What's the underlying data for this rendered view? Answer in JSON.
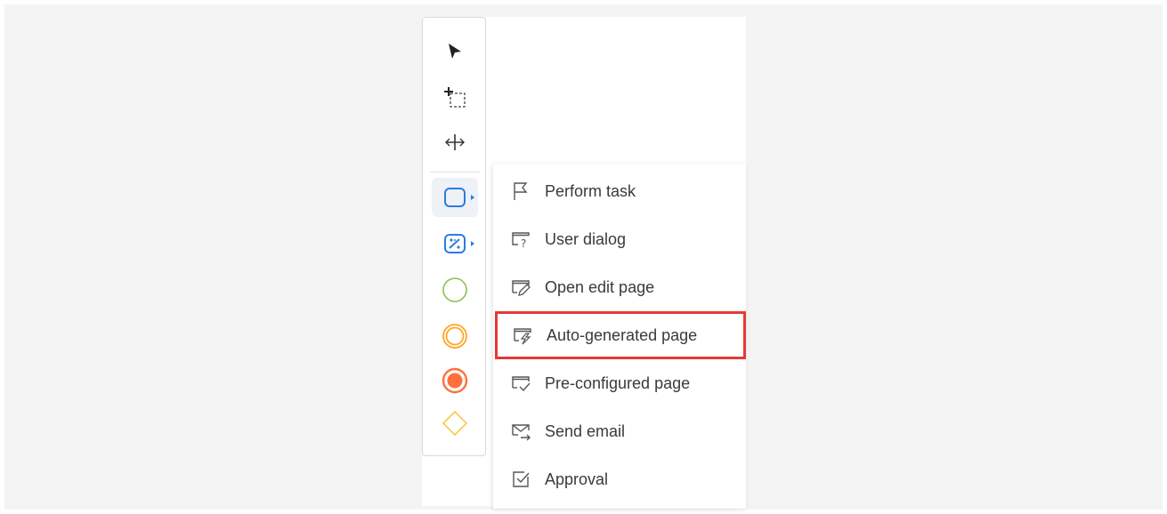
{
  "colors": {
    "accent_blue": "#2b7be5",
    "start_event_green": "#8bc34a",
    "intermediate_event_orange": "#ffa726",
    "end_event_orange": "#ff6f3c",
    "gateway_yellow": "#f9c74f",
    "highlight_red": "#e53935"
  },
  "toolbar": {
    "tools": [
      {
        "icon": "pointer-arrow-icon"
      },
      {
        "icon": "marquee-select-icon"
      },
      {
        "icon": "space-tool-icon"
      },
      {
        "icon": "task-shape-icon",
        "active": true
      },
      {
        "icon": "script-task-icon"
      },
      {
        "icon": "start-event-icon"
      },
      {
        "icon": "intermediate-event-icon"
      },
      {
        "icon": "end-event-icon"
      },
      {
        "icon": "gateway-icon"
      }
    ]
  },
  "menu": {
    "items": [
      {
        "label": "Perform task",
        "icon": "flag-icon"
      },
      {
        "label": "User dialog",
        "icon": "user-dialog-icon"
      },
      {
        "label": "Open edit page",
        "icon": "edit-page-icon"
      },
      {
        "label": "Auto-generated page",
        "icon": "auto-page-icon",
        "highlighted": true
      },
      {
        "label": "Pre-configured page",
        "icon": "preconfigured-page-icon"
      },
      {
        "label": "Send email",
        "icon": "send-email-icon"
      },
      {
        "label": "Approval",
        "icon": "approval-icon"
      }
    ]
  }
}
